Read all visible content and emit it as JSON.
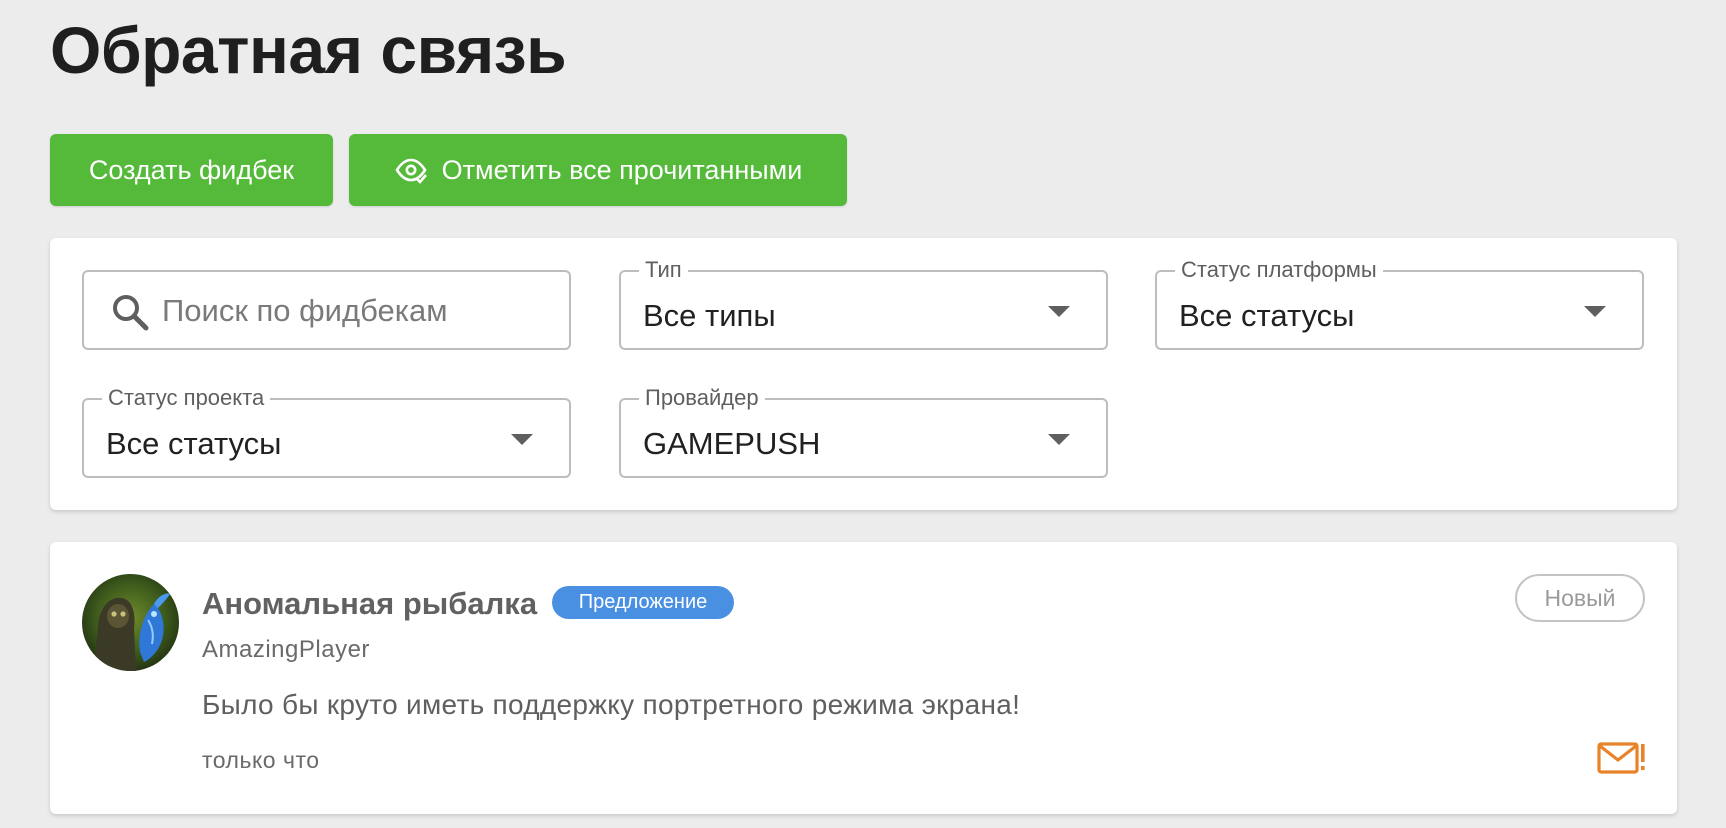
{
  "page": {
    "title": "Обратная связь"
  },
  "actions": {
    "create_label": "Создать фидбек",
    "mark_read_label": "Отметить все прочитанными"
  },
  "filters": {
    "search": {
      "placeholder": "Поиск по фидбекам",
      "value": ""
    },
    "type": {
      "label": "Тип",
      "value": "Все типы"
    },
    "platform_status": {
      "label": "Статус платформы",
      "value": "Все статусы"
    },
    "project_status": {
      "label": "Статус проекта",
      "value": "Все статусы"
    },
    "provider": {
      "label": "Провайдер",
      "value": "GAMEPUSH"
    }
  },
  "feedback_items": [
    {
      "title": "Аномальная рыбалка",
      "type_badge": "Предложение",
      "author": "AmazingPlayer",
      "text": "Было бы круто иметь поддержку портретного режима экрана!",
      "time": "только что",
      "status": "Новый"
    }
  ],
  "colors": {
    "accent_green": "#55b93a",
    "badge_blue": "#4a90e2",
    "unread_orange": "#e8832a"
  },
  "icons": {
    "mark_read": "eye-check-icon",
    "search": "search-icon",
    "dropdown": "caret-down-icon",
    "unread": "mail-alert-icon"
  }
}
